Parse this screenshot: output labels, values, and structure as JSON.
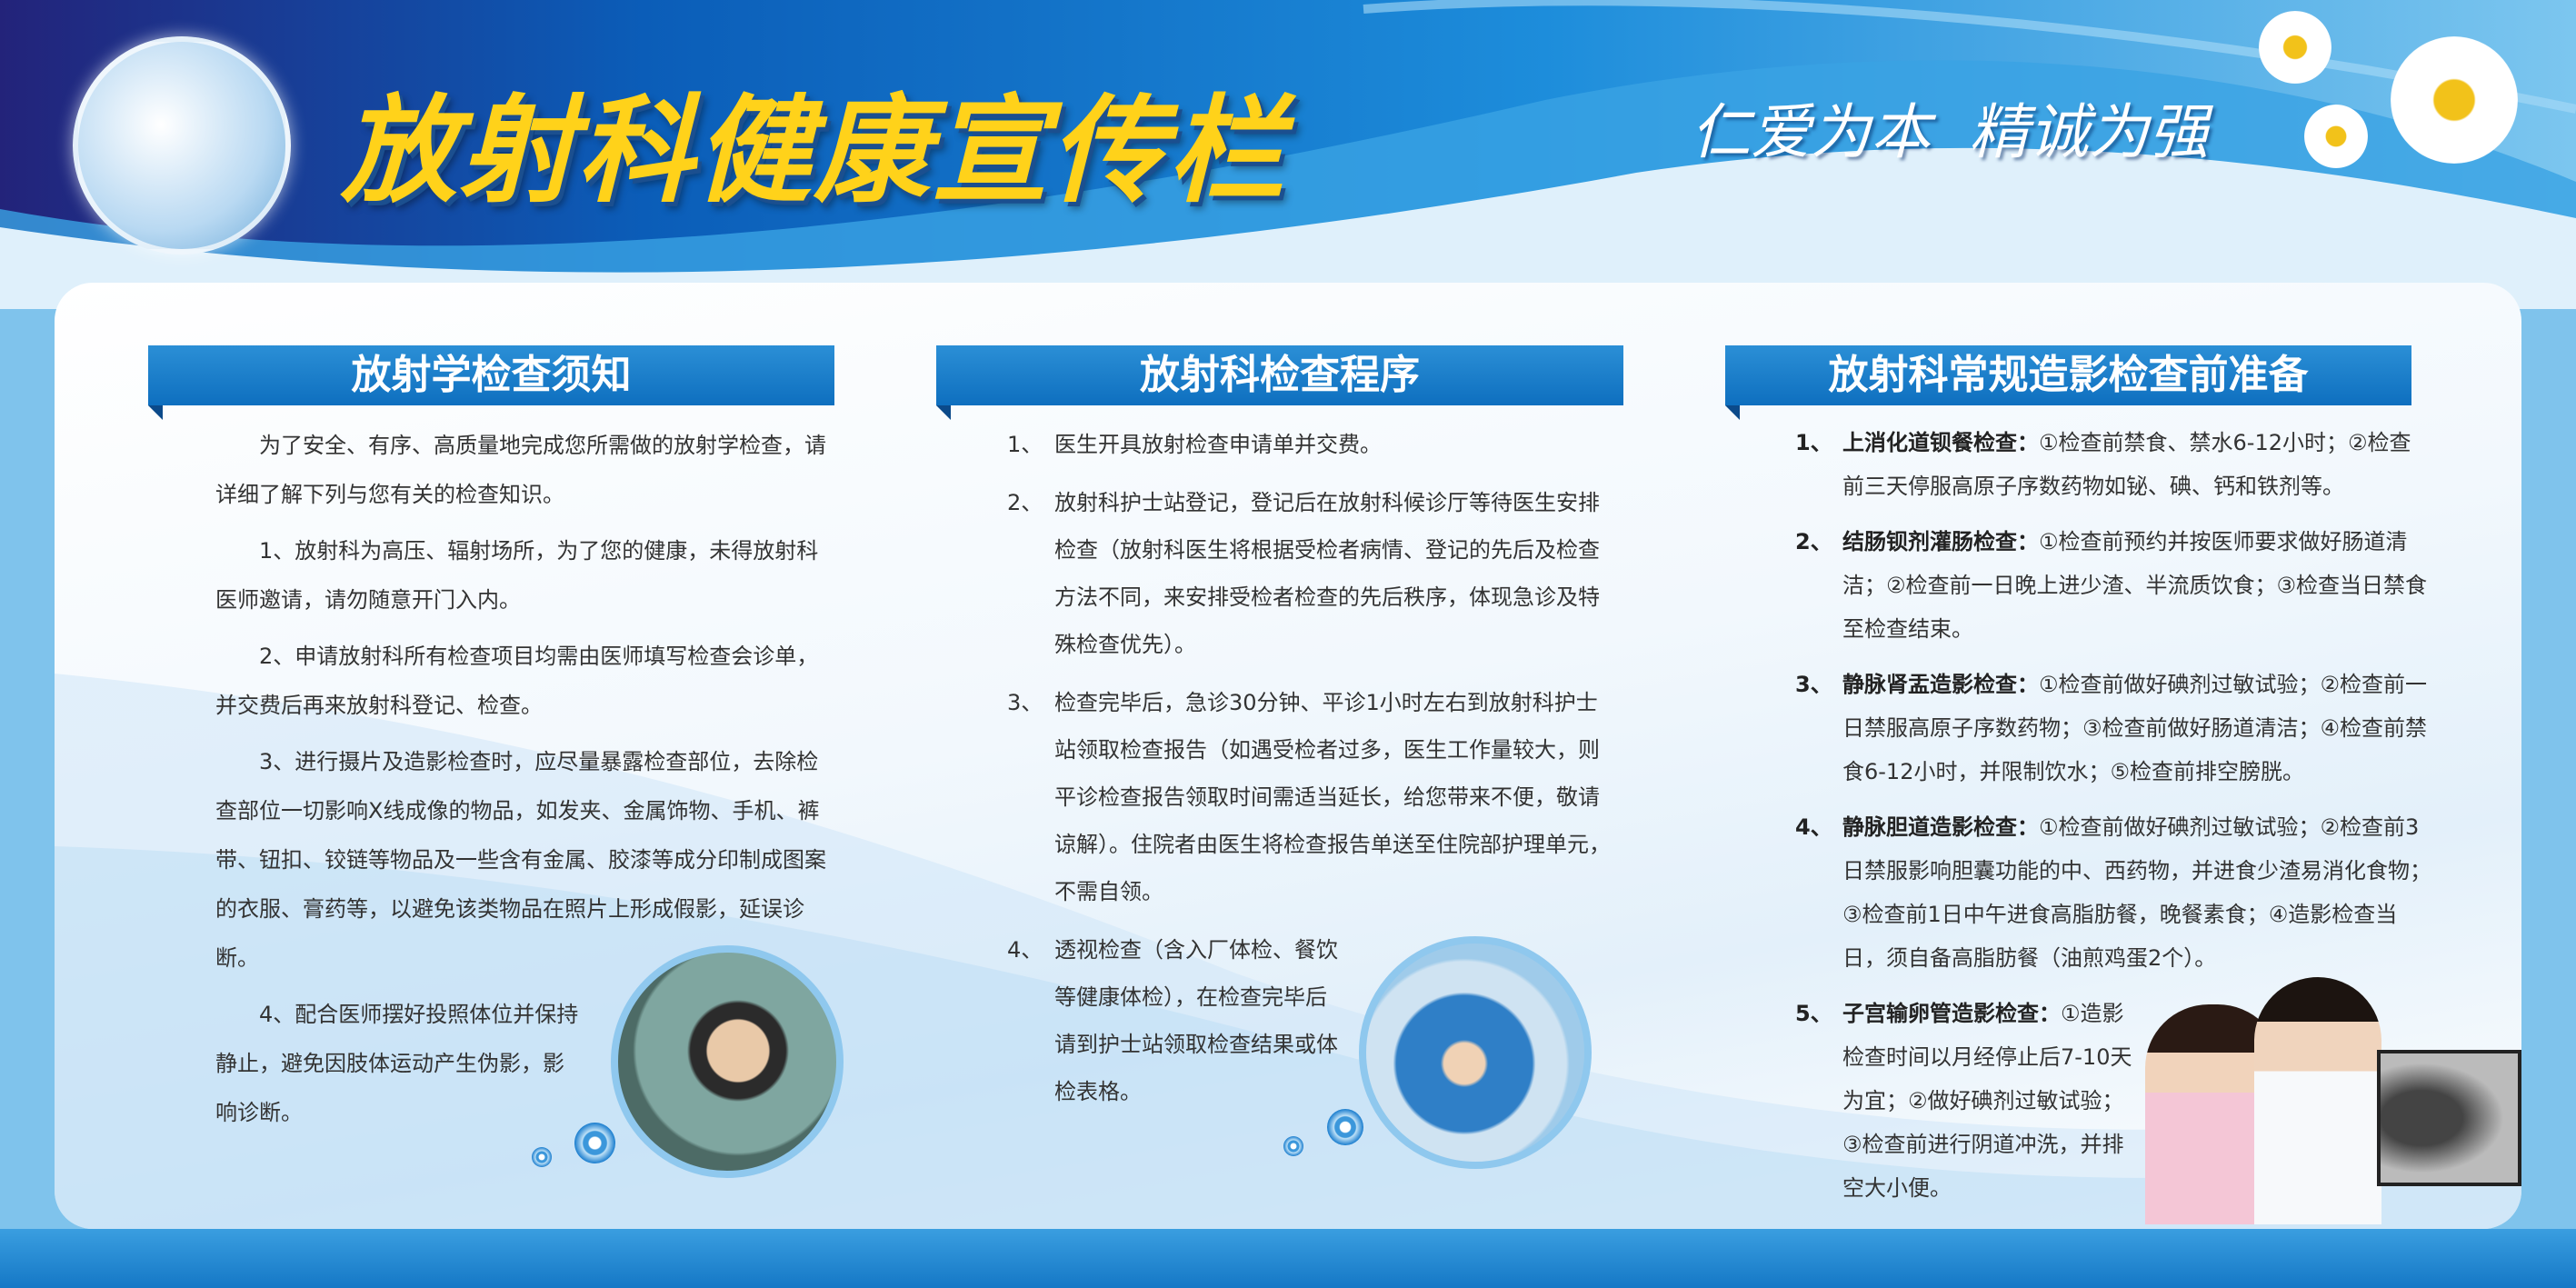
{
  "header": {
    "title": "放射科健康宣传栏",
    "slogan": "仁爱为本  精诚为强"
  },
  "colors": {
    "title": "#ffd21a",
    "header_blue": "#0e6fbf",
    "accent": "#2b8fd6"
  },
  "columns": [
    {
      "title": "放射学检查须知",
      "paragraphs": [
        "为了安全、有序、高质量地完成您所需做的放射学检查，请详细了解下列与您有关的检查知识。",
        "1、放射科为高压、辐射场所，为了您的健康，未得放射科医师邀请，请勿随意开门入内。",
        "2、申请放射科所有检查项目均需由医师填写检查会诊单，并交费后再来放射科登记、检查。",
        "3、进行摄片及造影检查时，应尽量暴露检查部位，去除检查部位一切影响X线成像的物品，如发夹、金属饰物、手机、裤带、钮扣、铰链等物品及一些含有金属、胶漆等成分印制成图案的衣服、膏药等，以避免该类物品在照片上形成假影，延误诊断。",
        "4、配合医师摆好投照体位并保持静止，避免因肢体运动产生伪影，影响诊断。"
      ]
    },
    {
      "title": "放射科检查程序",
      "items": [
        {
          "num": "1、",
          "text": "医生开具放射检查申请单并交费。"
        },
        {
          "num": "2、",
          "text": "放射科护士站登记，登记后在放射科候诊厅等待医生安排检查（放射科医生将根据受检者病情、登记的先后及检查方法不同，来安排受检者检查的先后秩序，体现急诊及特殊检查优先）。"
        },
        {
          "num": "3、",
          "text": "检查完毕后，急诊30分钟、平诊1小时左右到放射科护士站领取检查报告（如遇受检者过多，医生工作量较大，则平诊检查报告领取时间需适当延长，给您带来不便，敬请谅解）。住院者由医生将检查报告单送至住院部护理单元，不需自领。"
        },
        {
          "num": "4、",
          "text": "透视检查（含入厂体检、餐饮等健康体检），在检查完毕后请到护士站领取检查结果或体检表格。"
        }
      ]
    },
    {
      "title": "放射科常规造影检查前准备",
      "items": [
        {
          "num": "1、",
          "lead": "上消化道钡餐检查：",
          "text": "①检查前禁食、禁水6-12小时；②检查前三天停服高原子序数药物如铋、碘、钙和铁剂等。"
        },
        {
          "num": "2、",
          "lead": "结肠钡剂灌肠检查：",
          "text": "①检查前预约并按医师要求做好肠道清洁；②检查前一日晚上进少渣、半流质饮食；③检查当日禁食至检查结束。"
        },
        {
          "num": "3、",
          "lead": "静脉肾盂造影检查：",
          "text": "①检查前做好碘剂过敏试验；②检查前一日禁服高原子序数药物；③检查前做好肠道清洁；④检查前禁食6-12小时，并限制饮水；⑤检查前排空膀胱。"
        },
        {
          "num": "4、",
          "lead": "静脉胆道造影检查：",
          "text": "①检查前做好碘剂过敏试验；②检查前3日禁服影响胆囊功能的中、西药物，并进食少渣易消化食物；③检查前1日中午进食高脂肪餐，晚餐素食；④造影检查当日，须自备高脂肪餐（油煎鸡蛋2个）。"
        },
        {
          "num": "5、",
          "lead": "子宫输卵管造影检查：",
          "text": "①造影检查时间以月经停止后7-10天为宜；②做好碘剂过敏试验；③检查前进行阴道冲洗，并排空大小便。"
        }
      ]
    }
  ]
}
